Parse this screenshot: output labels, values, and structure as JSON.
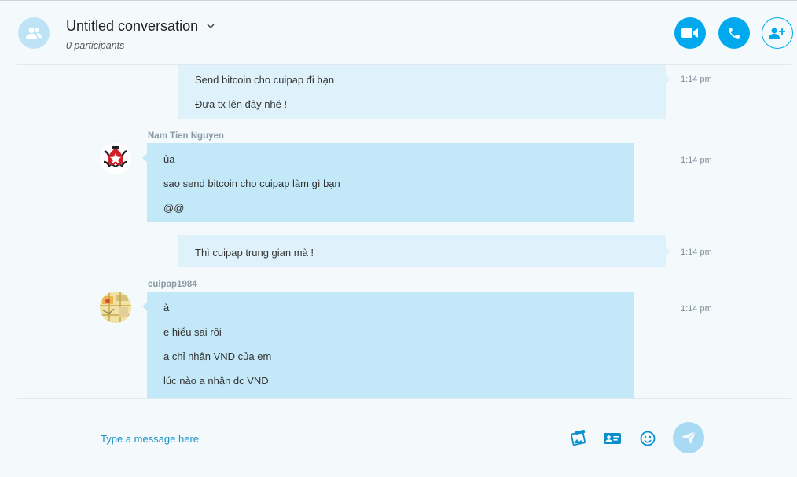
{
  "header": {
    "title": "Untitled conversation",
    "participants": "0 participants",
    "icons": {
      "group": "group-icon",
      "video": "video-icon",
      "call": "phone-icon",
      "add": "add-person-icon"
    }
  },
  "messages": [
    {
      "from": "me",
      "lines": [
        "Send bitcoin cho cuipap đi bạn",
        "Đưa tx lên đây nhé !"
      ],
      "time": "1:14 pm"
    },
    {
      "from": "Nam Tien Nguyen",
      "lines": [
        "ủa",
        "sao send bitcoin cho cuipap làm gì bạn",
        "@@"
      ],
      "time": "1:14 pm"
    },
    {
      "from": "me",
      "lines": [
        "Thì cuipap trung gian mà !"
      ],
      "time": "1:14 pm"
    },
    {
      "from": "cuipap1984",
      "lines": [
        "à",
        "e hiểu sai rồi",
        "a chỉ nhận VND của em",
        "lúc nào a nhận dc VND"
      ],
      "time": "1:14 pm"
    }
  ],
  "composer": {
    "placeholder": "Type a message here",
    "icons": {
      "media": "image-icon",
      "contact": "contact-card-icon",
      "emoji": "emoji-icon",
      "send": "send-icon"
    }
  },
  "colors": {
    "accent": "#00a9ee",
    "bubble_mine": "#dff2fb",
    "bubble_theirs": "#c3e8f8"
  }
}
